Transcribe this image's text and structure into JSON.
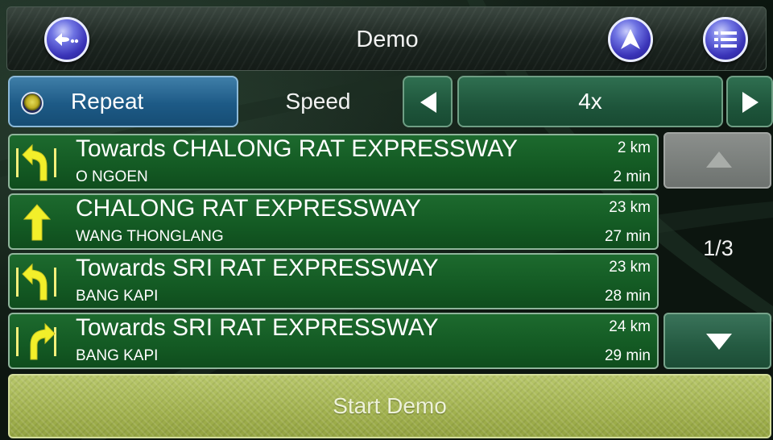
{
  "header": {
    "title": "Demo",
    "back_icon": "back-ellipsis-icon",
    "compass_icon": "navigation-arrow-icon",
    "menu_icon": "list-menu-icon"
  },
  "controls": {
    "repeat_label": "Repeat",
    "repeat_selected": true,
    "speed_label": "Speed",
    "speed_value": "4x"
  },
  "route": {
    "items": [
      {
        "road": "Towards CHALONG RAT EXPRESSWAY",
        "area": "O NGOEN",
        "distance": "2 km",
        "time": "2 min",
        "icon": "keep-left-icon"
      },
      {
        "road": "CHALONG RAT EXPRESSWAY",
        "area": "WANG THONGLANG",
        "distance": "23 km",
        "time": "27 min",
        "icon": "straight-arrow-icon"
      },
      {
        "road": "Towards SRI RAT EXPRESSWAY",
        "area": "BANG KAPI",
        "distance": "23 km",
        "time": "28 min",
        "icon": "keep-left-icon"
      },
      {
        "road": "Towards SRI RAT EXPRESSWAY",
        "area": "BANG KAPI",
        "distance": "24 km",
        "time": "29 min",
        "icon": "keep-right-icon"
      }
    ]
  },
  "pager": {
    "indicator": "1/3"
  },
  "footer": {
    "start_label": "Start Demo"
  },
  "colors": {
    "route_item_green": "#145b24",
    "accent_blue": "#1d5a86",
    "start_button": "#a2b24f",
    "arrow_yellow": "#f2ef2a"
  }
}
